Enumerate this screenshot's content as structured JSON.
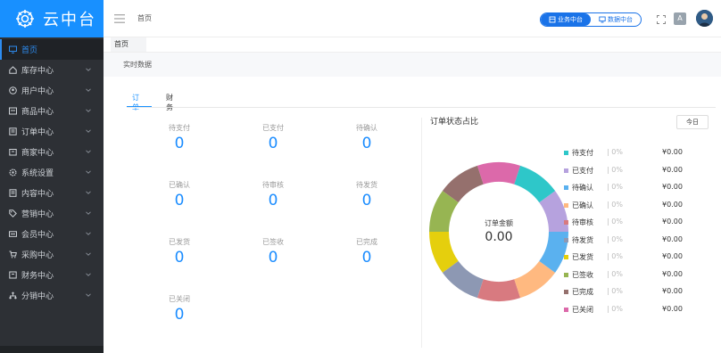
{
  "logo": {
    "text": "云中台"
  },
  "sidebar": {
    "items": [
      {
        "label": "首页",
        "icon": "monitor-icon",
        "active": true,
        "chevron": false
      },
      {
        "label": "库存中心",
        "icon": "home-icon",
        "chevron": true
      },
      {
        "label": "用户中心",
        "icon": "user-circle-icon",
        "chevron": true
      },
      {
        "label": "商品中心",
        "icon": "card-icon",
        "chevron": true
      },
      {
        "label": "订单中心",
        "icon": "list-icon",
        "chevron": true
      },
      {
        "label": "商家中心",
        "icon": "store-icon",
        "chevron": true
      },
      {
        "label": "系统设置",
        "icon": "gear-icon",
        "chevron": true
      },
      {
        "label": "内容中心",
        "icon": "doc-icon",
        "chevron": true
      },
      {
        "label": "营销中心",
        "icon": "tag-icon",
        "chevron": true
      },
      {
        "label": "会员中心",
        "icon": "vip-card-icon",
        "chevron": true
      },
      {
        "label": "采购中心",
        "icon": "cart-icon",
        "chevron": true
      },
      {
        "label": "财务中心",
        "icon": "wallet-icon",
        "chevron": true
      },
      {
        "label": "分销中心",
        "icon": "share-icon",
        "chevron": true
      }
    ]
  },
  "header": {
    "title": "首页",
    "switch": {
      "business": "业务中台",
      "data": "数据中台"
    },
    "lang": "A"
  },
  "tabbar": {
    "tab": "首页"
  },
  "realtime": {
    "label": "实时数据"
  },
  "main": {
    "tabs": [
      "订单",
      "财务"
    ],
    "stats": [
      {
        "label": "待支付",
        "value": "0"
      },
      {
        "label": "已支付",
        "value": "0"
      },
      {
        "label": "待确认",
        "value": "0"
      },
      {
        "label": "已确认",
        "value": "0"
      },
      {
        "label": "待审核",
        "value": "0"
      },
      {
        "label": "待发货",
        "value": "0"
      },
      {
        "label": "已发货",
        "value": "0"
      },
      {
        "label": "已签收",
        "value": "0"
      },
      {
        "label": "已完成",
        "value": "0"
      },
      {
        "label": "已关闭",
        "value": "0"
      }
    ],
    "pie": {
      "title": "订单状态占比",
      "today": "今日",
      "center_label": "订单金额",
      "center_value": "0.00"
    }
  },
  "chart_data": {
    "type": "pie",
    "title": "订单状态占比",
    "categories": [
      "待支付",
      "已支付",
      "待确认",
      "已确认",
      "待审核",
      "待发货",
      "已发货",
      "已签收",
      "已完成",
      "已关闭"
    ],
    "values": [
      10,
      10,
      10,
      10,
      10,
      10,
      10,
      10,
      10,
      10
    ],
    "percent_labels": [
      "0%",
      "0%",
      "0%",
      "0%",
      "0%",
      "0%",
      "0%",
      "0%",
      "0%",
      "0%"
    ],
    "amounts": [
      "¥0.00",
      "¥0.00",
      "¥0.00",
      "¥0.00",
      "¥0.00",
      "¥0.00",
      "¥0.00",
      "¥0.00",
      "¥0.00",
      "¥0.00"
    ],
    "colors": [
      "#2ec7c9",
      "#b6a2de",
      "#5ab1ef",
      "#ffb980",
      "#d87a80",
      "#8d98b3",
      "#e5cf0d",
      "#97b552",
      "#95706d",
      "#dc69aa"
    ],
    "legend_placement": "right"
  }
}
